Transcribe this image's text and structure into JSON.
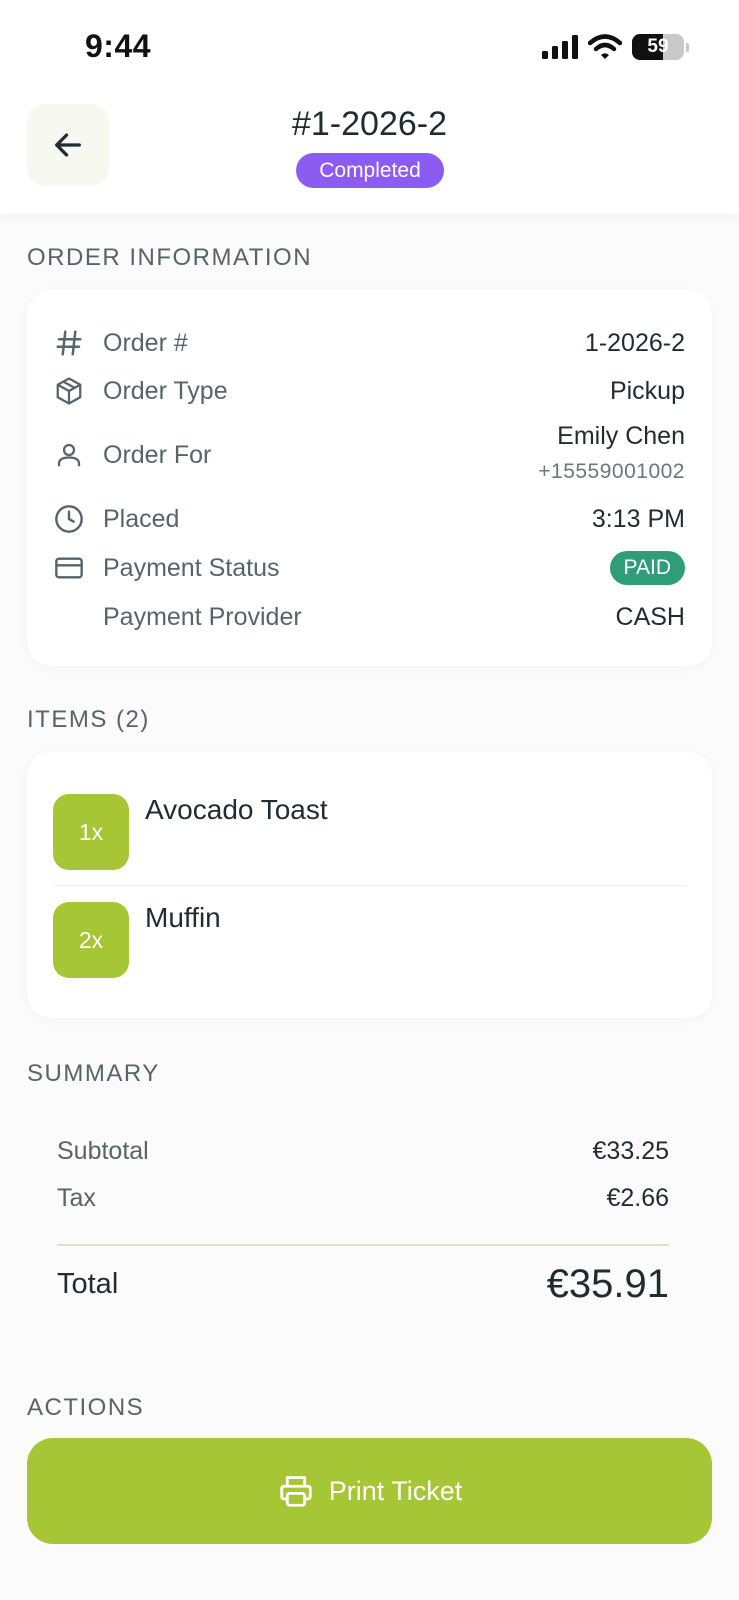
{
  "status_bar": {
    "time": "9:44",
    "battery": "59"
  },
  "header": {
    "title": "#1-2026-2",
    "status": "Completed"
  },
  "order_info": {
    "section_label": "ORDER INFORMATION",
    "rows": [
      {
        "label": "Order #",
        "value": "1-2026-2"
      },
      {
        "label": "Order Type",
        "value": "Pickup"
      },
      {
        "label": "Order For",
        "value": "Emily Chen",
        "sub": "+15559001002"
      },
      {
        "label": "Placed",
        "value": "3:13 PM"
      },
      {
        "label": "Payment Status",
        "value": "PAID"
      },
      {
        "label": "Payment Provider",
        "value": "CASH"
      }
    ]
  },
  "items": {
    "section_label": "ITEMS (2)",
    "list": [
      {
        "qty": "1x",
        "name": "Avocado Toast"
      },
      {
        "qty": "2x",
        "name": "Muffin"
      }
    ]
  },
  "summary": {
    "section_label": "SUMMARY",
    "subtotal_label": "Subtotal",
    "subtotal": "€33.25",
    "tax_label": "Tax",
    "tax": "€2.66",
    "total_label": "Total",
    "total": "€35.91"
  },
  "actions": {
    "section_label": "ACTIONS",
    "print_label": "Print Ticket"
  },
  "colors": {
    "accent": "#a6c636",
    "status_completed": "#8c5cf2",
    "paid": "#2e9d78"
  }
}
